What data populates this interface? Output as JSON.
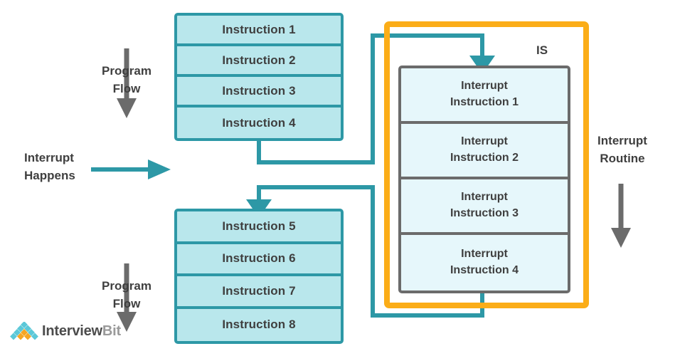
{
  "diagram": {
    "title": "Interrupt Handling Program Flow",
    "colors": {
      "instruction_fill": "#b9e7ec",
      "instruction_border": "#2d98a6",
      "interrupt_fill": "#e6f7fb",
      "interrupt_border": "#6b6b6b",
      "service_border": "#fbad18",
      "connector": "#2d98a6",
      "arrow_gray": "#6b6b6b",
      "text": "#3f3f3f",
      "background": "#ffffff"
    },
    "labels": {
      "program_flow_top": "Program\nFlow",
      "interrupt_happens": "Interrupt\nHappens",
      "program_flow_bottom": "Program\nFlow",
      "interrupt_routine": "Interrupt\nRoutine",
      "is": "IS"
    },
    "program_block_top": {
      "name": "main-program-block-top",
      "instructions": [
        "Instruction 1",
        "Instruction 2",
        "Instruction 3",
        "Instruction 4"
      ]
    },
    "program_block_bottom": {
      "name": "main-program-block-bottom",
      "instructions": [
        "Instruction 5",
        "Instruction 6",
        "Instruction 7",
        "Instruction 8"
      ]
    },
    "interrupt_service": {
      "name": "interrupt-service-routine",
      "instructions": [
        {
          "line1": "Interrupt",
          "line2": "Instruction 1"
        },
        {
          "line1": "Interrupt",
          "line2": "Instruction 2"
        },
        {
          "line1": "Interrupt",
          "line2": "Instruction 3"
        },
        {
          "line1": "Interrupt",
          "line2": "Instruction 4"
        }
      ]
    }
  },
  "branding": {
    "name_primary": "Interview",
    "name_secondary": "Bit"
  }
}
